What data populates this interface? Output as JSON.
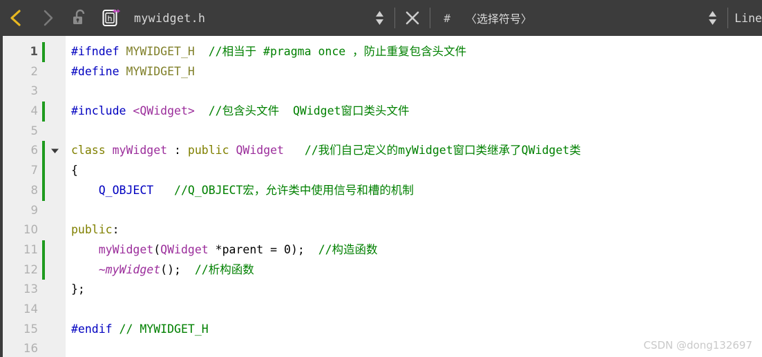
{
  "toolbar": {
    "back_icon": "chevron-left-icon",
    "forward_icon": "chevron-right-icon",
    "lock_icon": "unlocked-padlock-icon",
    "file_type_icon": "h-cpp-header-file-icon",
    "file_name": "mywidget.h",
    "file_spinner_icon": "updown-spinner-icon",
    "close_icon": "close-x-icon",
    "hash_symbol": "#",
    "symbol_selector": "〈选择符号〉",
    "symbol_spinner_icon": "updown-spinner-icon",
    "line_label": "Line",
    "colors": {
      "background": "#3c3c3c",
      "back_arrow_active": "#e8b820",
      "forward_arrow_disabled": "#7a7a7a",
      "text": "#d8d8d8",
      "accent_magenta": "#c040c0"
    }
  },
  "editor": {
    "colors": {
      "gutter_background": "#efefef",
      "code_background": "#ffffff",
      "change_bar": "#1f9b1f",
      "preprocessor": "#0000c0",
      "macro": "#80802a",
      "keyword": "#808000",
      "type": "#9b2d9b",
      "comment": "#008000",
      "line_number": "#b0b0b0",
      "line_number_current": "#555555"
    },
    "lines": [
      {
        "number": "1",
        "current": true,
        "changed": true,
        "fold": false,
        "tokens": [
          {
            "cls": "t-pre",
            "text": "#ifndef"
          },
          {
            "cls": "t-plain",
            "text": " "
          },
          {
            "cls": "t-macro",
            "text": "MYWIDGET_H"
          },
          {
            "cls": "t-plain",
            "text": "  "
          },
          {
            "cls": "t-cmt",
            "text": "//相当于 #pragma once ，防止重复包含头文件"
          }
        ]
      },
      {
        "number": "2",
        "current": false,
        "changed": false,
        "fold": false,
        "tokens": [
          {
            "cls": "t-pre",
            "text": "#define"
          },
          {
            "cls": "t-plain",
            "text": " "
          },
          {
            "cls": "t-macro",
            "text": "MYWIDGET_H"
          }
        ]
      },
      {
        "number": "3",
        "current": false,
        "changed": false,
        "fold": false,
        "tokens": []
      },
      {
        "number": "4",
        "current": false,
        "changed": true,
        "fold": false,
        "tokens": [
          {
            "cls": "t-pre",
            "text": "#include"
          },
          {
            "cls": "t-plain",
            "text": " "
          },
          {
            "cls": "t-type",
            "text": "<QWidget>"
          },
          {
            "cls": "t-plain",
            "text": "  "
          },
          {
            "cls": "t-cmt",
            "text": "//包含头文件  QWidget窗口类头文件"
          }
        ]
      },
      {
        "number": "5",
        "current": false,
        "changed": false,
        "fold": false,
        "tokens": []
      },
      {
        "number": "6",
        "current": false,
        "changed": true,
        "fold": true,
        "tokens": [
          {
            "cls": "t-kw",
            "text": "class"
          },
          {
            "cls": "t-plain",
            "text": " "
          },
          {
            "cls": "t-type",
            "text": "myWidget"
          },
          {
            "cls": "t-plain",
            "text": " : "
          },
          {
            "cls": "t-kw",
            "text": "public"
          },
          {
            "cls": "t-plain",
            "text": " "
          },
          {
            "cls": "t-type",
            "text": "QWidget"
          },
          {
            "cls": "t-plain",
            "text": "   "
          },
          {
            "cls": "t-cmt",
            "text": "//我们自己定义的myWidget窗口类继承了QWidget类"
          }
        ]
      },
      {
        "number": "7",
        "current": false,
        "changed": true,
        "fold": false,
        "tokens": [
          {
            "cls": "t-plain",
            "text": "{"
          }
        ]
      },
      {
        "number": "8",
        "current": false,
        "changed": true,
        "fold": false,
        "tokens": [
          {
            "cls": "t-plain",
            "text": "    "
          },
          {
            "cls": "t-pre",
            "text": "Q_OBJECT"
          },
          {
            "cls": "t-plain",
            "text": "   "
          },
          {
            "cls": "t-cmt",
            "text": "//Q_OBJECT宏，允许类中使用信号和槽的机制"
          }
        ]
      },
      {
        "number": "9",
        "current": false,
        "changed": false,
        "fold": false,
        "tokens": []
      },
      {
        "number": "10",
        "current": false,
        "changed": false,
        "fold": false,
        "tokens": [
          {
            "cls": "t-kw",
            "text": "public"
          },
          {
            "cls": "t-plain",
            "text": ":"
          }
        ]
      },
      {
        "number": "11",
        "current": false,
        "changed": true,
        "fold": false,
        "tokens": [
          {
            "cls": "t-plain",
            "text": "    "
          },
          {
            "cls": "t-type",
            "text": "myWidget"
          },
          {
            "cls": "t-plain",
            "text": "("
          },
          {
            "cls": "t-type",
            "text": "QWidget"
          },
          {
            "cls": "t-plain",
            "text": " *parent = "
          },
          {
            "cls": "t-num",
            "text": "0"
          },
          {
            "cls": "t-plain",
            "text": ");"
          },
          {
            "cls": "t-plain",
            "text": "  "
          },
          {
            "cls": "t-cmt",
            "text": "//构造函数"
          }
        ]
      },
      {
        "number": "12",
        "current": false,
        "changed": true,
        "fold": false,
        "tokens": [
          {
            "cls": "t-plain",
            "text": "    "
          },
          {
            "cls": "t-ital",
            "text": "~myWidget"
          },
          {
            "cls": "t-plain",
            "text": "();"
          },
          {
            "cls": "t-plain",
            "text": "  "
          },
          {
            "cls": "t-cmt",
            "text": "//析构函数"
          }
        ]
      },
      {
        "number": "13",
        "current": false,
        "changed": false,
        "fold": false,
        "tokens": [
          {
            "cls": "t-plain",
            "text": "};"
          }
        ]
      },
      {
        "number": "14",
        "current": false,
        "changed": false,
        "fold": false,
        "tokens": []
      },
      {
        "number": "15",
        "current": false,
        "changed": false,
        "fold": false,
        "tokens": [
          {
            "cls": "t-pre",
            "text": "#endif"
          },
          {
            "cls": "t-plain",
            "text": " "
          },
          {
            "cls": "t-cmt",
            "text": "// MYWIDGET_H"
          }
        ]
      },
      {
        "number": "16",
        "current": false,
        "changed": false,
        "fold": false,
        "tokens": []
      }
    ]
  },
  "watermark": {
    "text": "CSDN @dong132697"
  }
}
